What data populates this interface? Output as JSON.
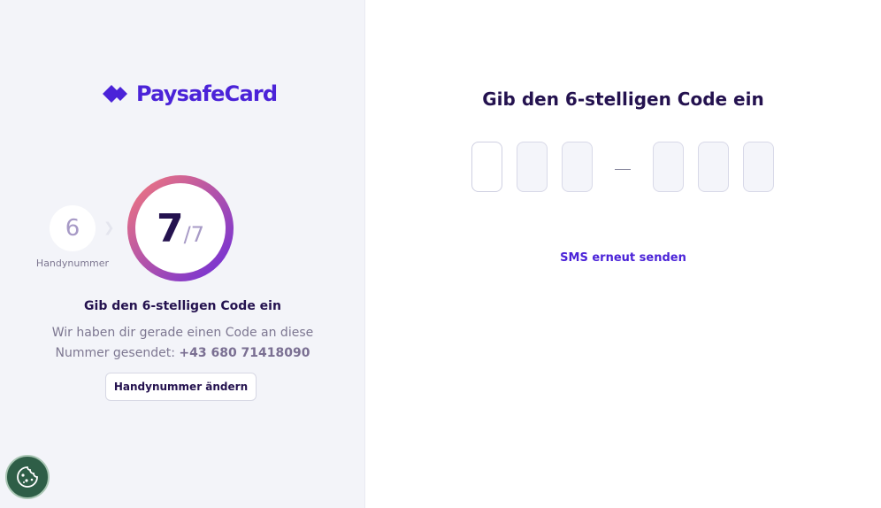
{
  "brand": {
    "name": "PaysafeCard",
    "color": "#4b23d8"
  },
  "stepper": {
    "previous_step_number": "6",
    "previous_step_label": "Handynummer",
    "current_step": "7",
    "total_steps_label": "/7",
    "progress_fraction": 1.0,
    "ring_gradient": [
      "#f77a7a",
      "#6a2bdc"
    ]
  },
  "left": {
    "title": "Gib den 6-stelligen Code ein",
    "description_line1": "Wir haben dir gerade einen Code an diese",
    "description_line2_prefix": "Nummer gesendet: ",
    "phone_number": "+43 680 71418090",
    "change_button_label": "Handynummer ändern"
  },
  "right": {
    "title": "Gib den 6-stelligen Code ein",
    "code_digits": [
      "",
      "",
      "",
      "",
      "",
      ""
    ],
    "resend_label": "SMS erneut senden"
  },
  "cookie": {
    "icon": "cookie-icon",
    "background": "#2e5e47"
  },
  "colors": {
    "text_dark": "#24124f",
    "text_muted": "#7d7791",
    "panel_bg": "#f3f4f9"
  }
}
